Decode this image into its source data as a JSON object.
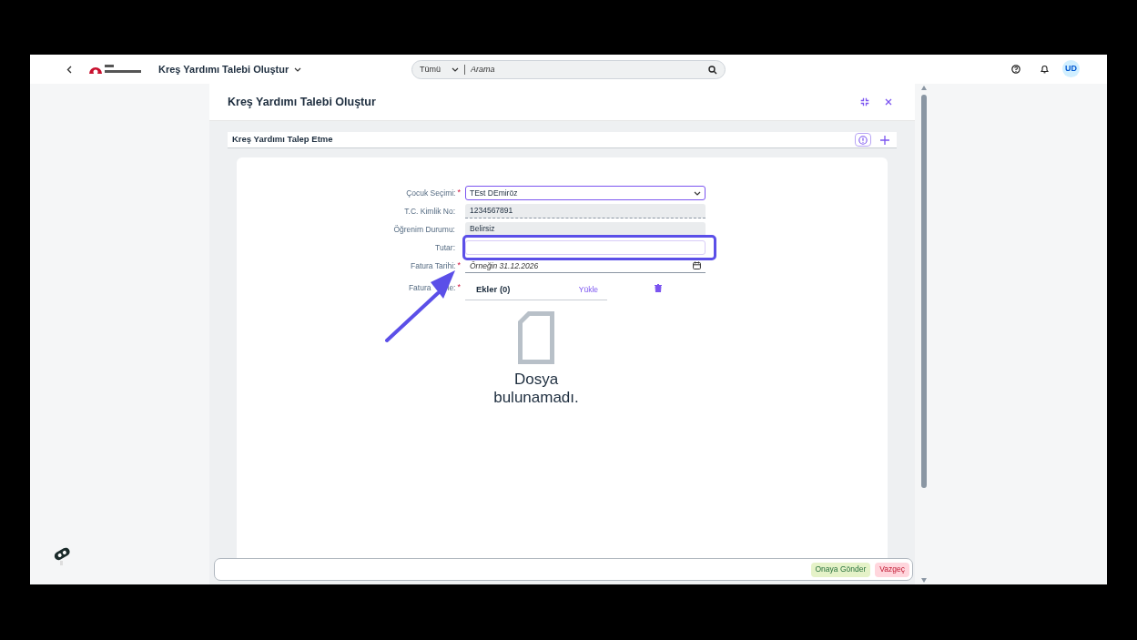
{
  "shell_bar": {
    "app_title": "Kreş Yardımı Talebi Oluştur",
    "search": {
      "scope": "Tümü",
      "placeholder": "Arama"
    },
    "avatar": "UD"
  },
  "dialog": {
    "title": "Kreş Yardımı Talebi Oluştur",
    "section_title": "Kreş Yardımı Talep Etme",
    "fields": [
      {
        "kind": "select",
        "label": "Çocuk Seçimi:",
        "required_mark": "*",
        "value": "TEst DEmiröz"
      },
      {
        "kind": "readonly",
        "label": "T.C. Kimlik No:",
        "value": "1234567891"
      },
      {
        "kind": "readonly",
        "label": "Öğrenim Durumu:",
        "value": "Belirsiz"
      },
      {
        "kind": "input",
        "label": "Tutar:"
      },
      {
        "kind": "date",
        "label": "Fatura Tarihi:",
        "required_mark": "*",
        "placeholder": "Örneğin 31.12.2026"
      },
      {
        "kind": "upload",
        "label": "Fatura",
        "label_end": "le:",
        "required_mark": "*",
        "attachments_title": "Ekler (0)",
        "upload_link": "Yükle",
        "empty_text": "Dosya bulunamadı."
      }
    ],
    "buttons": [
      {
        "label": "Onaya Gönder",
        "kind": "accept"
      },
      {
        "label": "Vazgeç",
        "kind": "reject"
      }
    ]
  }
}
